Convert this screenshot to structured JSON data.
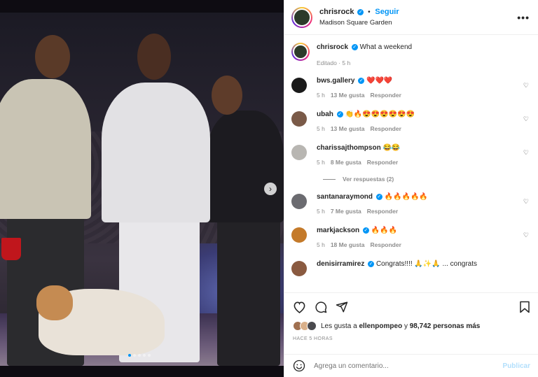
{
  "post": {
    "username": "chrisrock",
    "follow_label": "Seguir",
    "location": "Madison Square Garden",
    "more_icon": "more-horizontal-icon"
  },
  "caption": {
    "username": "chrisrock",
    "text": "What a weekend",
    "edited_label": "Editado",
    "time": "5 h"
  },
  "comments": [
    {
      "username": "bws.gallery",
      "verified": true,
      "text": "❤️❤️❤️",
      "time": "5 h",
      "likes": "13 Me gusta",
      "reply": "Responder",
      "avatar_color": "#1a1a1a"
    },
    {
      "username": "ubah",
      "verified": true,
      "text": "👏🔥😍😍😍😍😍😍",
      "time": "5 h",
      "likes": "13 Me gusta",
      "reply": "Responder",
      "avatar_color": "#7a5a48"
    },
    {
      "username": "charissajthompson",
      "verified": false,
      "text": "😂😂",
      "time": "5 h",
      "likes": "8 Me gusta",
      "reply": "Responder",
      "avatar_color": "#b8b6b2"
    },
    {
      "username": "santanaraymond",
      "verified": true,
      "text": "🔥🔥🔥🔥🔥",
      "time": "5 h",
      "likes": "7 Me gusta",
      "reply": "Responder",
      "avatar_color": "#6b6b70"
    },
    {
      "username": "markjackson",
      "verified": true,
      "text": "🔥🔥🔥",
      "time": "5 h",
      "likes": "18 Me gusta",
      "reply": "Responder",
      "avatar_color": "#c47a2a"
    },
    {
      "username": "denisirramirez",
      "verified": true,
      "text": "Congrats!!!! 🙏✨🙏 ... congrats",
      "time": "",
      "likes": "",
      "reply": "",
      "avatar_color": "#8a5a40"
    }
  ],
  "view_replies": "Ver respuestas (2)",
  "likes": {
    "prefix": "Les gusta a",
    "user": "ellenpompeo",
    "connector": "y",
    "others": "98,742 personas más"
  },
  "timestamp": "HACE 5 HORAS",
  "add_comment": {
    "placeholder": "Agrega un comentario...",
    "post_label": "Publicar"
  },
  "colors": {
    "accent": "#0095f6",
    "muted": "#8e8e8e",
    "post_disabled": "#b2dffc"
  }
}
